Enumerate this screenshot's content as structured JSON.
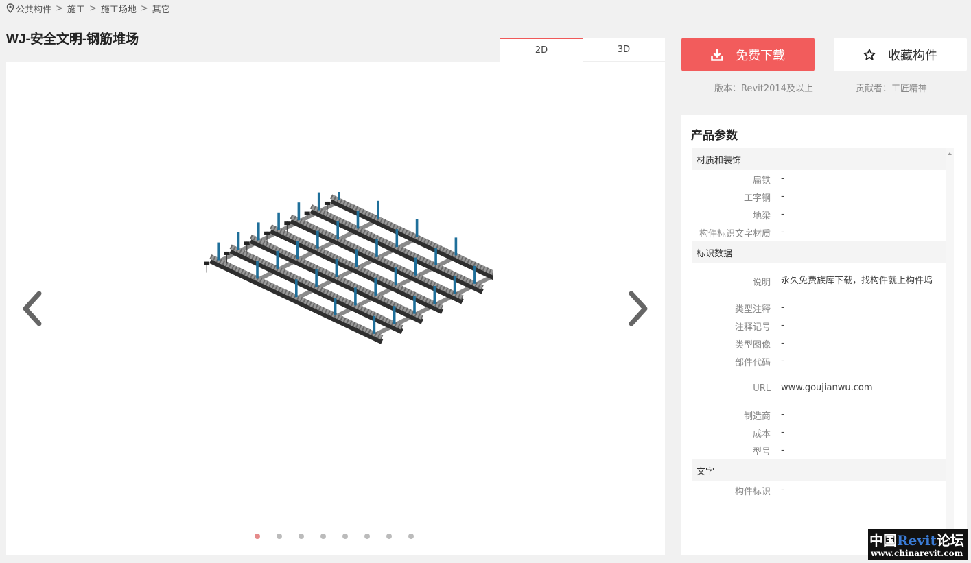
{
  "breadcrumb": [
    "公共构件",
    "施工",
    "施工场地",
    "其它"
  ],
  "title": "WJ-安全文明-钢筋堆场",
  "viewer": {
    "tabs": [
      "2D",
      "3D"
    ],
    "active_tab": "2D",
    "slide_count": 8,
    "active_slide": 0
  },
  "actions": {
    "download_label": "免费下载",
    "favorite_label": "收藏构件",
    "version": "版本：Revit2014及以上",
    "contributor": "贡献者：工匠精神"
  },
  "params": {
    "heading": "产品参数",
    "groups": [
      {
        "name": "材质和装饰",
        "rows": [
          {
            "k": "扁铁",
            "v": "-"
          },
          {
            "k": "工字钢",
            "v": "-"
          },
          {
            "k": "地梁",
            "v": "-"
          },
          {
            "k": "构件标识文字材质",
            "v": "-"
          }
        ]
      },
      {
        "name": "标识数据",
        "rows": [
          {
            "k": "说明",
            "v": "永久免费族库下载，找构件就上构件坞"
          },
          {
            "k": "类型注释",
            "v": "-"
          },
          {
            "k": "注释记号",
            "v": "-"
          },
          {
            "k": "类型图像",
            "v": "-"
          },
          {
            "k": "部件代码",
            "v": "-"
          },
          {
            "k": "URL",
            "v": "www.goujianwu.com"
          },
          {
            "k": "制造商",
            "v": "-"
          },
          {
            "k": "成本",
            "v": "-"
          },
          {
            "k": "型号",
            "v": "-"
          }
        ]
      },
      {
        "name": "文字",
        "rows": [
          {
            "k": "构件标识",
            "v": "-"
          }
        ]
      }
    ]
  },
  "watermark": {
    "line1_a": "中国",
    "line1_b": "Revit",
    "line1_c": "论坛",
    "line2": "www.chinarevit.com"
  },
  "colors": {
    "accent": "#f25c5c",
    "rebar": "#1f6f9a",
    "beam": "#4a4a4a"
  }
}
